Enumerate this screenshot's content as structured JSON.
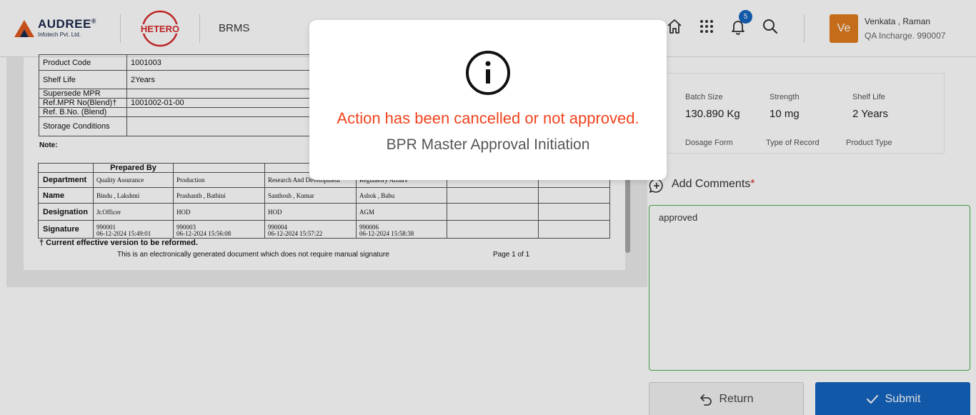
{
  "header": {
    "company_name": "AUDREE",
    "company_reg": "®",
    "company_sub": "Infotech Pvt. Ltd.",
    "client_logo_text": "HETERO",
    "app_name": "BRMS",
    "notification_count": "5",
    "user": {
      "initials": "Ve",
      "name": "Venkata , Raman",
      "role": "QA Incharge. 990007"
    }
  },
  "document": {
    "info_rows": [
      {
        "label": "Product Code",
        "value": "1001003"
      },
      {
        "label": "Shelf Life",
        "value": "2Years"
      },
      {
        "label": "Supersede MPR",
        "value": ""
      },
      {
        "label": "Ref.MPR No(Blend)†",
        "value": "1001002-01-00"
      },
      {
        "label": "Ref. B.No. (Blend)",
        "value": ""
      },
      {
        "label": "Storage Conditions",
        "value": ""
      }
    ],
    "note_label": "Note:",
    "prepared_by": "Prepared By",
    "row_labels": {
      "department": "Department",
      "name": "Name",
      "designation": "Designation",
      "signature": "Signature"
    },
    "columns": [
      {
        "department": "Quality Assurance",
        "name": "Bindu , Lakshmi",
        "designation": "Jr.Officer",
        "sig_id": "990001",
        "sig_time": "06-12-2024 15:49:01"
      },
      {
        "department": "Production",
        "name": "Prashanth , Bathini",
        "designation": "HOD",
        "sig_id": "990003",
        "sig_time": "06-12-2024 15:56:08"
      },
      {
        "department": "Research And Development",
        "name": "Santhosh , Kumar",
        "designation": "HOD",
        "sig_id": "990004",
        "sig_time": "06-12-2024 15:57:22"
      },
      {
        "department": "Regulatory Affairs",
        "name": "Ashok , Babu",
        "designation": "AGM",
        "sig_id": "990006",
        "sig_time": "06-12-2024 15:58:38"
      }
    ],
    "dagger_note": "† Current effective version to be reformed.",
    "footer_note": "This is an electronically generated document which does not require manual signature",
    "page_label": "Page 1 of 1"
  },
  "details": {
    "batch_size_label": "Batch Size",
    "batch_size": "130.890 Kg",
    "strength_label": "Strength",
    "strength": "10 mg",
    "shelf_life_label": "Shelf Life",
    "shelf_life": "2 Years",
    "dosage_form_label": "Dosage Form",
    "record_type_label": "Type of Record",
    "product_type_label": "Product Type"
  },
  "comments": {
    "title": "Add Comments",
    "required_mark": "*",
    "value": "approved"
  },
  "actions": {
    "return_label": "Return",
    "submit_label": "Submit"
  },
  "modal": {
    "title": "Action has been cancelled or not approved.",
    "subtitle": "BPR Master Approval Initiation"
  },
  "colors": {
    "primary": "#1565c0",
    "alert": "#f0441e",
    "avatar": "#e07b1e",
    "comment_border": "#4caf50"
  }
}
